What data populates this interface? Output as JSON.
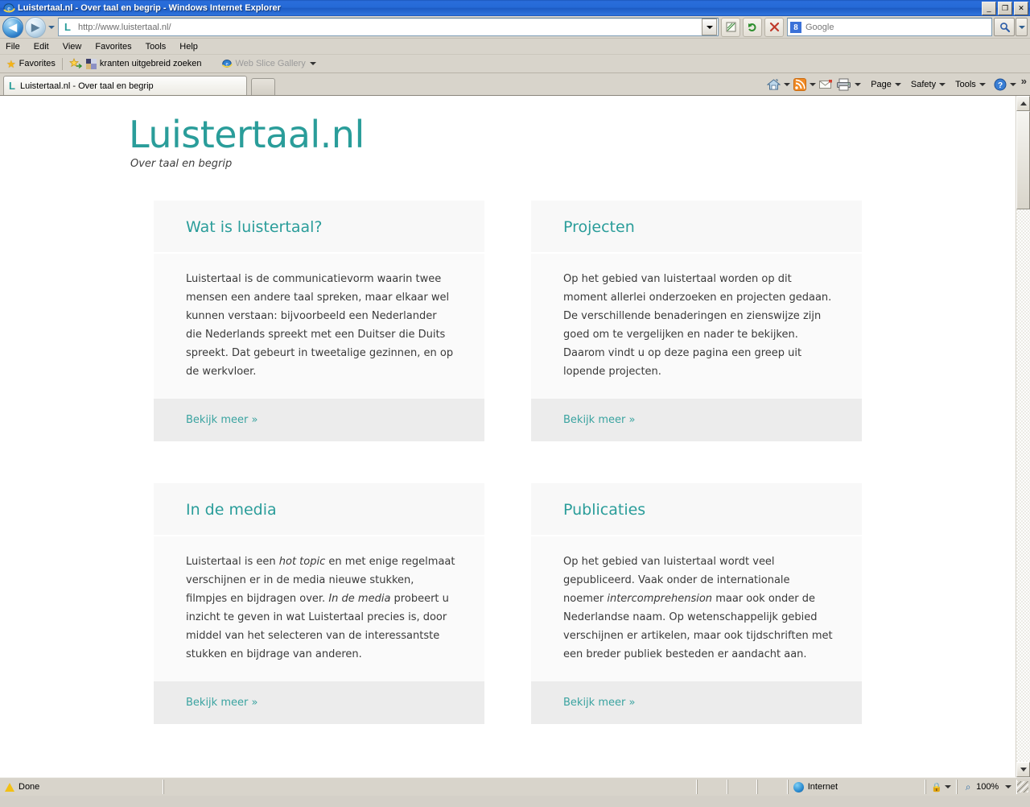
{
  "browser": {
    "title": "Luistertaal.nl - Over taal en begrip - Windows Internet Explorer",
    "window_controls": {
      "minimize": "_",
      "maximize": "❐",
      "close": "✕"
    },
    "nav": {
      "back": "◀",
      "forward": "▶",
      "history_dropdown": "history-dropdown"
    },
    "address": {
      "url": "http://www.luistertaal.nl/",
      "favicon_letter": "L",
      "dropdown": "address-dropdown"
    },
    "toolbuttons": {
      "compatibility": "⬚",
      "refresh": "↻",
      "stop": "✕"
    },
    "search": {
      "provider_glyph": "8",
      "placeholder": "Google",
      "go": "⌕",
      "dropdown": "search-dropdown"
    },
    "menu": [
      "File",
      "Edit",
      "View",
      "Favorites",
      "Tools",
      "Help"
    ],
    "favorites_bar": {
      "favorites_label": "Favorites",
      "items": [
        {
          "label": "kranten uitgebreid zoeken",
          "icon": "page-icon"
        },
        {
          "label": "Web Slice Gallery",
          "icon": "webslice-icon",
          "dimmed": true
        }
      ]
    },
    "tabs": [
      {
        "label": "Luistertaal.nl - Over taal en begrip",
        "favicon_letter": "L",
        "active": true
      }
    ],
    "new_tab_label": "",
    "command_bar": [
      {
        "name": "home",
        "label": "",
        "icon": "home-icon",
        "has_caret": true
      },
      {
        "name": "feeds",
        "label": "",
        "icon": "rss-icon",
        "has_caret": true
      },
      {
        "name": "mail",
        "label": "",
        "icon": "mail-icon",
        "has_caret": false
      },
      {
        "name": "print",
        "label": "",
        "icon": "printer-icon",
        "has_caret": true
      },
      {
        "name": "page",
        "label": "Page",
        "icon": "",
        "has_caret": true
      },
      {
        "name": "safety",
        "label": "Safety",
        "icon": "",
        "has_caret": true
      },
      {
        "name": "tools",
        "label": "Tools",
        "icon": "",
        "has_caret": true
      },
      {
        "name": "help",
        "label": "",
        "icon": "help-icon",
        "has_caret": true
      }
    ],
    "overflow_chevron": "»",
    "status": {
      "text": "Done",
      "zone": "Internet",
      "zoom": "100%",
      "protected_mode_icon": "lock-icon",
      "zoom_icon": "magnifier-icon"
    },
    "scrollbar": {
      "up": "▲",
      "down": "▼"
    }
  },
  "site": {
    "logo": "Luistertaal.nl",
    "tagline": "Over taal en begrip",
    "accent_color": "#2a9d9a",
    "link_color": "#3aa3a0",
    "cards": [
      {
        "title": "Wat is luistertaal?",
        "body_html": "Luistertaal is de communicatievorm waarin twee mensen een andere taal spreken, maar elkaar wel kunnen verstaan: bijvoorbeeld een Nederlander die Nederlands spreekt met een Duitser die Duits spreekt. Dat gebeurt  in tweetalige gezinnen, en op de werkvloer.",
        "link": "Bekijk meer »"
      },
      {
        "title": "Projecten",
        "body_html": "Op het gebied van luistertaal worden op dit moment allerlei onderzoeken en projecten gedaan. De verschillende benaderingen en zienswijze zijn goed om te vergelijken en nader te bekijken. Daarom vindt u op deze pagina een greep uit lopende projecten.",
        "link": "Bekijk meer »"
      },
      {
        "title": "In de media",
        "body_html": "Luistertaal is een <em>hot topic</em> en met enige regelmaat verschijnen er in de media nieuwe stukken, filmpjes en bijdragen over. <em>In de media</em> probeert u inzicht te geven in wat Luistertaal precies is, door middel van het selecteren van de interessantste stukken en bijdrage van anderen.",
        "link": "Bekijk meer »"
      },
      {
        "title": "Publicaties",
        "body_html": "Op het gebied van luistertaal wordt veel gepubliceerd. Vaak onder de internationale noemer <em>intercomprehension</em> maar ook onder de Nederlandse naam. Op wetenschappelijk gebied verschijnen er artikelen, maar ook tijdschriften met een breder publiek besteden er aandacht aan.",
        "link": "Bekijk meer »"
      }
    ]
  }
}
